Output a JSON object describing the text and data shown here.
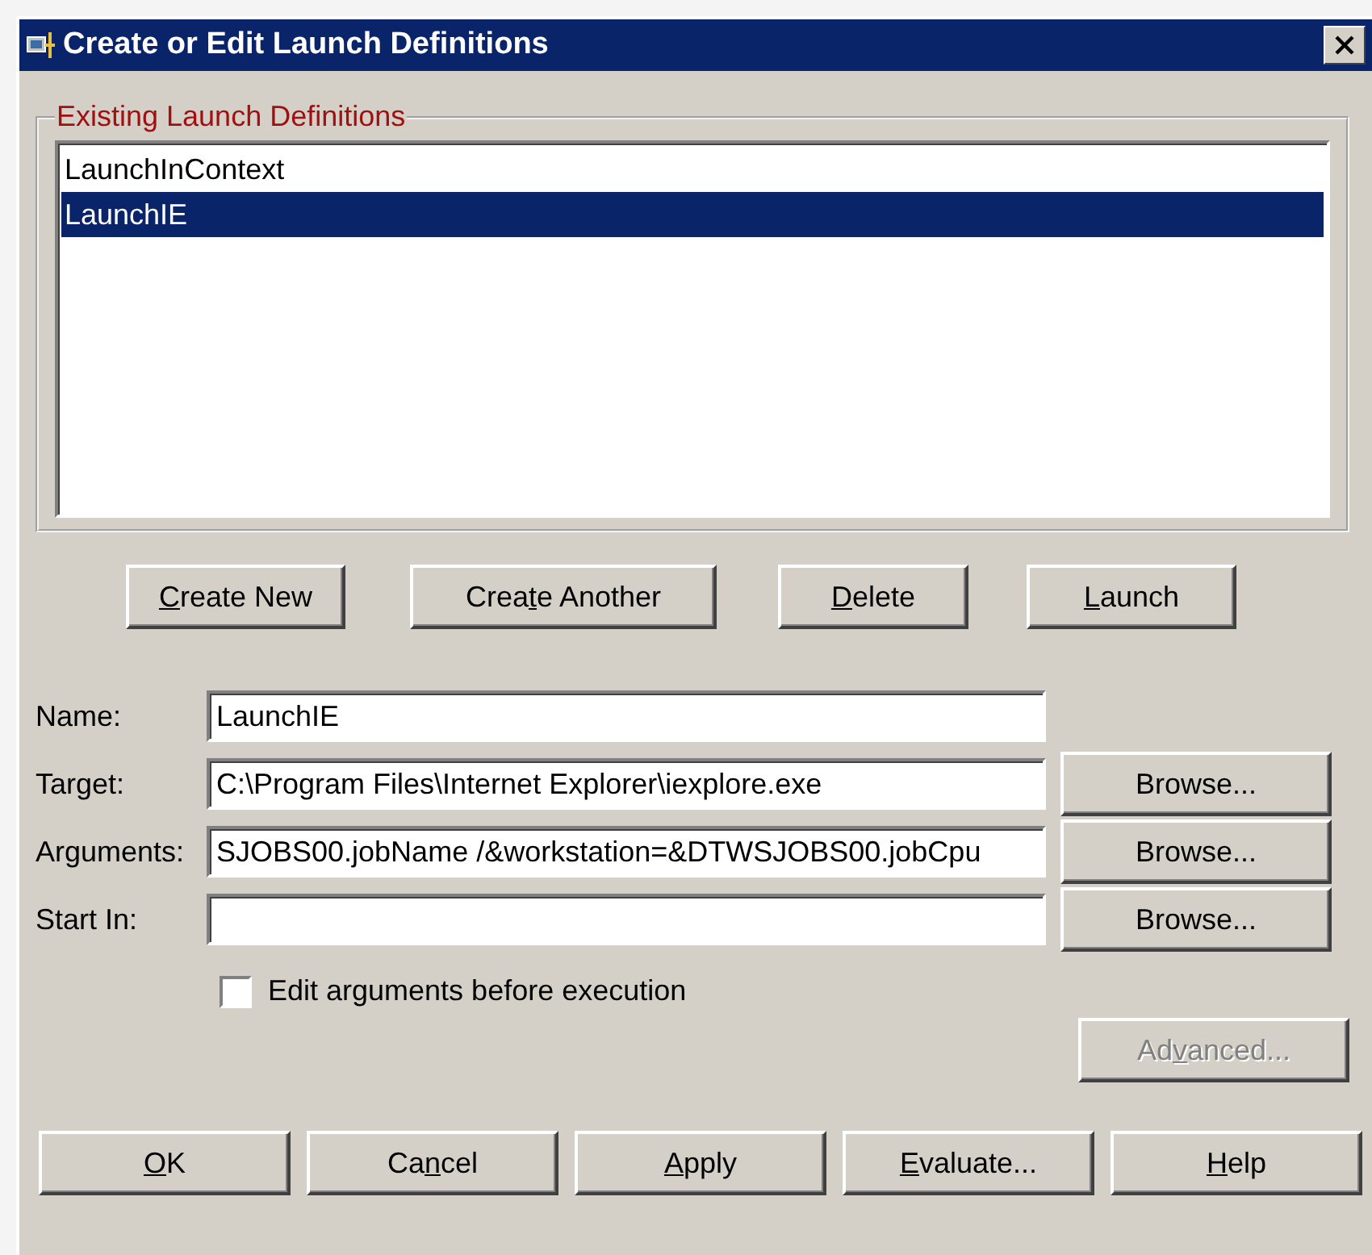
{
  "window": {
    "title": "Create or Edit Launch Definitions"
  },
  "definitions": {
    "label": "Existing Launch Definitions",
    "items": [
      {
        "label": "LaunchInContext",
        "selected": false
      },
      {
        "label": "LaunchIE",
        "selected": true
      }
    ]
  },
  "list_buttons": [
    {
      "label": [
        {
          "text": "C",
          "underlined": true
        },
        {
          "text": "reate New",
          "underlined": false
        }
      ]
    },
    {
      "label": [
        {
          "text": "Crea",
          "underlined": false
        },
        {
          "text": "t",
          "underlined": true
        },
        {
          "text": "e Another",
          "underlined": false
        }
      ]
    },
    {
      "label": [
        {
          "text": "D",
          "underlined": true
        },
        {
          "text": "elete",
          "underlined": false
        }
      ]
    },
    {
      "label": [
        {
          "text": "L",
          "underlined": true
        },
        {
          "text": "aunch",
          "underlined": false
        }
      ]
    }
  ],
  "fields": [
    {
      "label": "Name:",
      "value": "LaunchIE"
    },
    {
      "label": "Target:",
      "value": "C:\\Program Files\\Internet Explorer\\iexplore.exe",
      "browse": "Browse..."
    },
    {
      "label": "Arguments:",
      "value": "SJOBS00.jobName /&workstation=&DTWSJOBS00.jobCpu",
      "browse": "Browse..."
    },
    {
      "label": "Start In:",
      "browse": "Browse..."
    }
  ],
  "edit_arguments": {
    "label": "Edit arguments before execution",
    "checked": false
  },
  "advanced": {
    "label": [
      {
        "text": "Ad",
        "underlined": false
      },
      {
        "text": "v",
        "underlined": true
      },
      {
        "text": "anced...",
        "underlined": false
      }
    ],
    "disabled": true
  },
  "footer_buttons": [
    {
      "label": [
        {
          "text": "O",
          "underlined": true
        },
        {
          "text": "K",
          "underlined": false
        }
      ]
    },
    {
      "label": [
        {
          "text": "Ca",
          "underlined": false
        },
        {
          "text": "n",
          "underlined": true
        },
        {
          "text": "cel",
          "underlined": false
        }
      ]
    },
    {
      "label": [
        {
          "text": "A",
          "underlined": true
        },
        {
          "text": "pply",
          "underlined": false
        }
      ]
    },
    {
      "label": [
        {
          "text": "E",
          "underlined": true
        },
        {
          "text": "valuate...",
          "underlined": false
        }
      ]
    },
    {
      "label": [
        {
          "text": "H",
          "underlined": true
        },
        {
          "text": "elp",
          "underlined": false
        }
      ]
    }
  ]
}
